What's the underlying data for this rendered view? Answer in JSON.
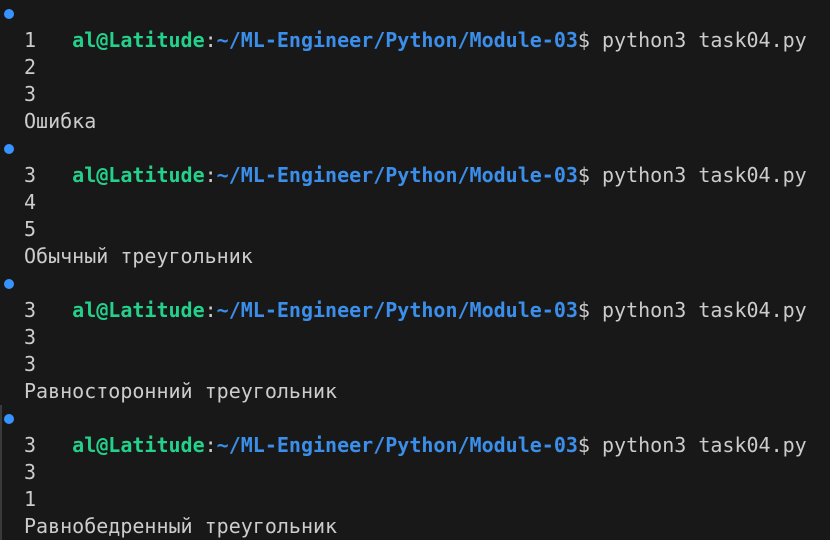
{
  "terminal": {
    "prompt_user_host": "al@Latitude",
    "prompt_colon": ":",
    "prompt_path": "~/ML-Engineer/Python/Module-03",
    "prompt_symbol": "$ ",
    "colors": {
      "background": "#181818",
      "user_host": "#23d18b",
      "path": "#3b8eea",
      "text": "#cccccc",
      "marker": "#3794ff"
    },
    "runs": [
      {
        "command": "python3 task04.py",
        "outputs": [
          "1",
          "2",
          "3",
          "Ошибка"
        ]
      },
      {
        "command": "python3 task04.py",
        "outputs": [
          "3",
          "4",
          "5",
          "Обычный треугольник"
        ]
      },
      {
        "command": "python3 task04.py",
        "outputs": [
          "3",
          "3",
          "3",
          "Равносторонний треугольник"
        ]
      },
      {
        "command": "python3 task04.py",
        "outputs": [
          "3",
          "3",
          "1",
          "Равнобедренный треугольник"
        ]
      }
    ]
  }
}
